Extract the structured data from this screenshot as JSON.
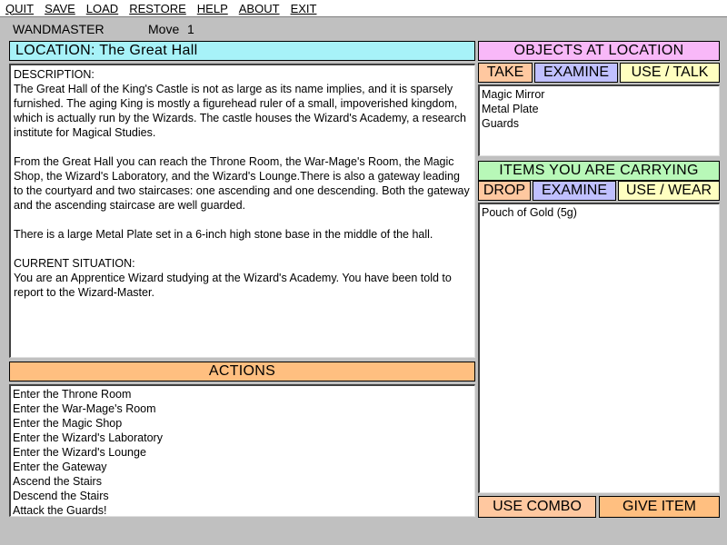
{
  "menu": [
    {
      "label": "QUIT"
    },
    {
      "label": "SAVE"
    },
    {
      "label": "LOAD"
    },
    {
      "label": "RESTORE"
    },
    {
      "label": "HELP"
    },
    {
      "label": "ABOUT"
    },
    {
      "label": "EXIT"
    }
  ],
  "app": {
    "title": "WANDMASTER",
    "move_label": "Move",
    "move_number": "1"
  },
  "location": {
    "header": "LOCATION:  The Great Hall",
    "description": "DESCRIPTION:\nThe Great Hall of the King's Castle is not as large as its name implies, and it is sparsely furnished. The aging King is mostly a figurehead ruler of a small, impoverished kingdom, which is actually run by the Wizards. The castle houses the Wizard's Academy, a research institute for Magical Studies.\n\nFrom the Great Hall you can reach the Throne Room, the War-Mage's Room, the Magic Shop, the Wizard's Laboratory, and the Wizard's Lounge.There is also a gateway leading to the courtyard and two staircases: one ascending and one descending. Both the gateway and the ascending staircase are well guarded.\n\nThere is a large Metal Plate set in a 6-inch high stone base in the middle of the hall.\n\nCURRENT SITUATION:\nYou are an Apprentice Wizard studying at the Wizard's Academy. You have been told to report to the Wizard-Master."
  },
  "actions": {
    "header": "ACTIONS",
    "items": [
      "Enter the Throne Room",
      "Enter the War-Mage's Room",
      "Enter the Magic Shop",
      "Enter the Wizard's Laboratory",
      "Enter the Wizard's Lounge",
      "Enter the Gateway",
      "Ascend the Stairs",
      "Descend the Stairs",
      "Attack the Guards!"
    ]
  },
  "objects": {
    "header": "OBJECTS AT LOCATION",
    "buttons": {
      "take": "TAKE",
      "examine": "EXAMINE",
      "use_talk": "USE / TALK"
    },
    "items": [
      "Magic Mirror",
      "Metal Plate",
      "Guards"
    ]
  },
  "inventory": {
    "header": "ITEMS YOU ARE CARRYING",
    "buttons": {
      "drop": "DROP",
      "examine": "EXAMINE",
      "use_wear": "USE / WEAR"
    },
    "items": [
      "Pouch of Gold (5g)"
    ]
  },
  "bottom_buttons": {
    "use_combo": "USE COMBO",
    "give_item": "GIVE ITEM"
  },
  "colors": {
    "location_header": "#a7f2f8",
    "actions_header": "#ffbf80",
    "objects_header": "#f8b8f8",
    "items_header": "#b8f8b8",
    "examine_button": "#c0c0ff",
    "use_button": "#ffffc0",
    "take_drop_button": "#ffc8a0"
  }
}
